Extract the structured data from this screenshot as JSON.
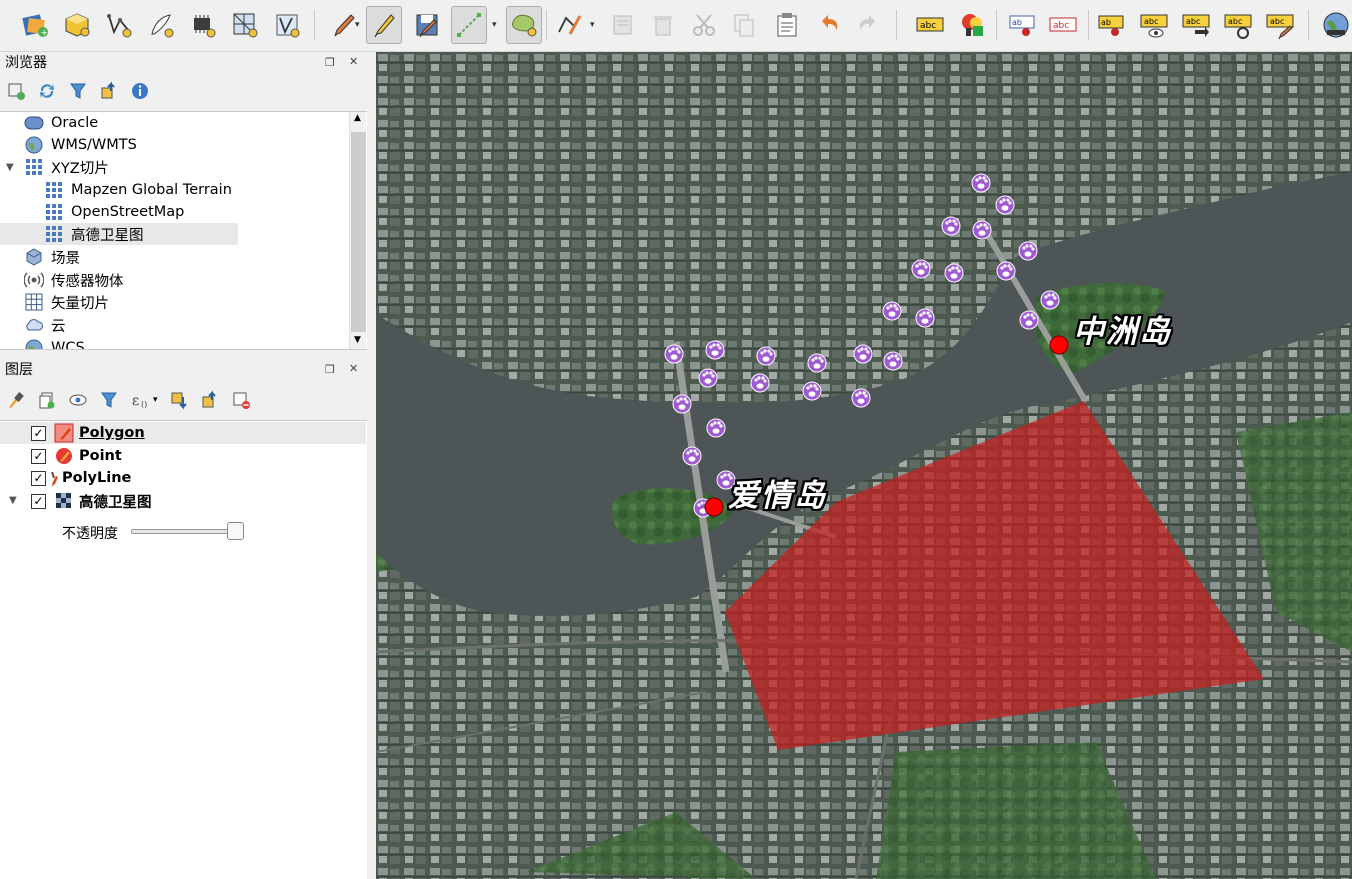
{
  "toolbar": {
    "icons": [
      "data-source-manager-icon",
      "new-geopackage-icon",
      "new-shapefile-icon",
      "digitize-icon",
      "new-memory-layer-icon",
      "new-virtual-layer-icon",
      "new-spatialite-icon",
      "edit-pencil-icon",
      "toggle-editing-icon",
      "save-edits-icon",
      "vertex-tool-icon",
      "add-polygon-icon",
      "vertex-editor-icon",
      "delete-icon",
      "cut-icon",
      "copy-icon",
      "paste-icon",
      "undo-icon",
      "redo-icon",
      "label-tool-icon",
      "style-manager-icon",
      "label-pin-icon",
      "label-highlight-icon",
      "label-move-icon",
      "label-show-icon",
      "label-rotate-icon",
      "label-change-icon",
      "label-edit-icon",
      "plugin-globe-icon"
    ],
    "label_text": "abc"
  },
  "browser": {
    "title": "浏览器",
    "items": [
      {
        "label": "Oracle",
        "icon": "database-icon",
        "level": 0,
        "expanded": false
      },
      {
        "label": "WMS/WMTS",
        "icon": "globe-icon",
        "level": 0,
        "expanded": false
      },
      {
        "label": "XYZ切片",
        "icon": "grid-icon",
        "level": 0,
        "expanded": true
      },
      {
        "label": "Mapzen Global Terrain",
        "icon": "grid-icon",
        "level": 1
      },
      {
        "label": "OpenStreetMap",
        "icon": "grid-icon",
        "level": 1
      },
      {
        "label": "高德卫星图",
        "icon": "grid-icon",
        "level": 1,
        "selected": true
      },
      {
        "label": "场景",
        "icon": "cube-icon",
        "level": 0
      },
      {
        "label": "传感器物体",
        "icon": "sensor-icon",
        "level": 0
      },
      {
        "label": "矢量切片",
        "icon": "grid-icon",
        "level": 0
      },
      {
        "label": "云",
        "icon": "cloud-icon",
        "level": 0
      },
      {
        "label": "WCS",
        "icon": "globe-icon",
        "level": 0
      }
    ]
  },
  "layers": {
    "title": "图层",
    "items": [
      {
        "label": "Polygon",
        "checked": true,
        "icon": "polygon-layer-icon",
        "selected": true
      },
      {
        "label": "Point",
        "checked": true,
        "icon": "point-layer-icon"
      },
      {
        "label": "PolyLine",
        "checked": true,
        "icon": "line-layer-icon"
      },
      {
        "label": "高德卫星图",
        "checked": true,
        "icon": "raster-layer-icon",
        "expanded": true
      }
    ],
    "opacity_label": "不透明度",
    "opacity_value": 1.0
  },
  "map": {
    "labels": [
      "中洲岛",
      "爱情岛"
    ],
    "polygon_color": "#c81e1e",
    "point_color": "#ff0000",
    "line_marker_color": "#a05ad2"
  }
}
